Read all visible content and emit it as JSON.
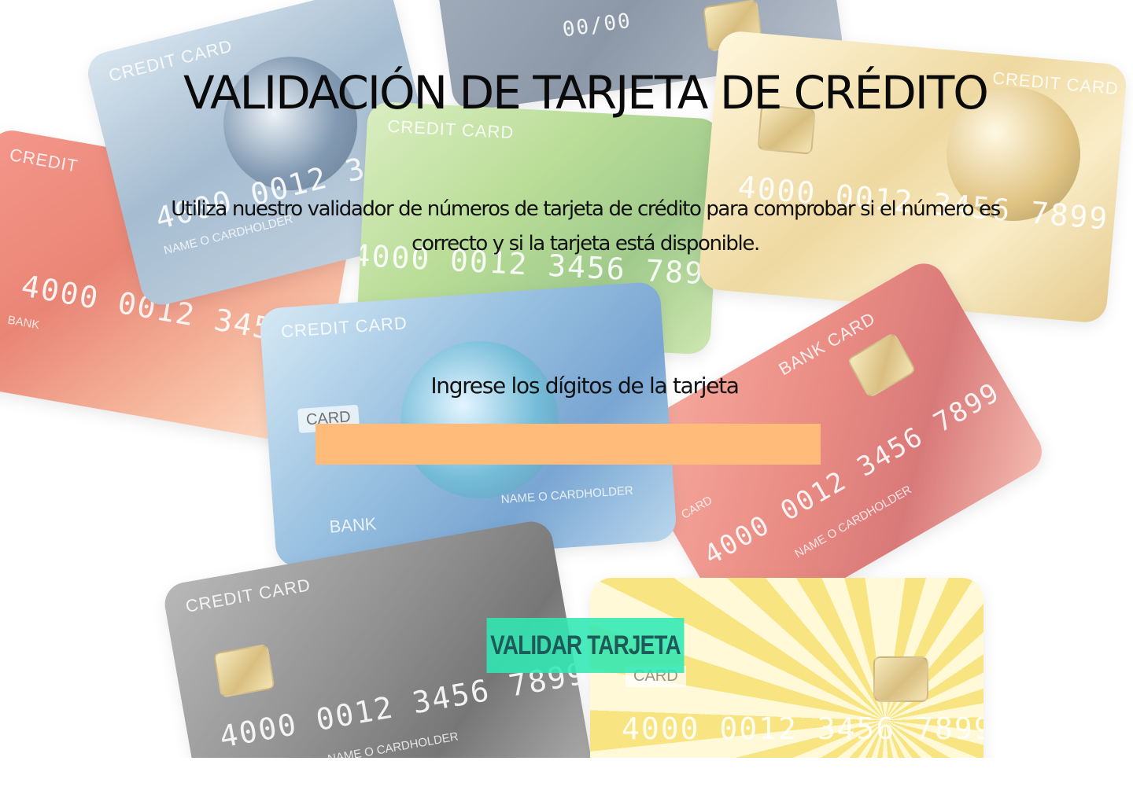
{
  "page": {
    "title": "VALIDACIÓN DE TARJETA DE CRÉDITO",
    "description": "Utiliza nuestro validador de números de tarjeta de crédito para comprobar si el número es correcto y si la tarjeta está disponible."
  },
  "form": {
    "input_label": "Ingrese los dígitos de la tarjeta",
    "input_value": "",
    "submit_label": "VALIDAR TARJETA"
  },
  "background_cards": {
    "credit_card_label": "CREDIT CARD",
    "bank_card_label": "BANK CARD",
    "credit_label": "CREDIT",
    "card_badge": "CARD",
    "bank_badge": "BANK",
    "number": "4000 0012 3456 7899",
    "number_short": "4000 0012 3456",
    "holder": "NAME O CARDHOLDER",
    "expiry": "00/00"
  },
  "colors": {
    "input_background": "#ffbb7a",
    "button_background": "#30e8b4",
    "button_text": "#1d5a58",
    "title_text": "#0a0a0a"
  }
}
